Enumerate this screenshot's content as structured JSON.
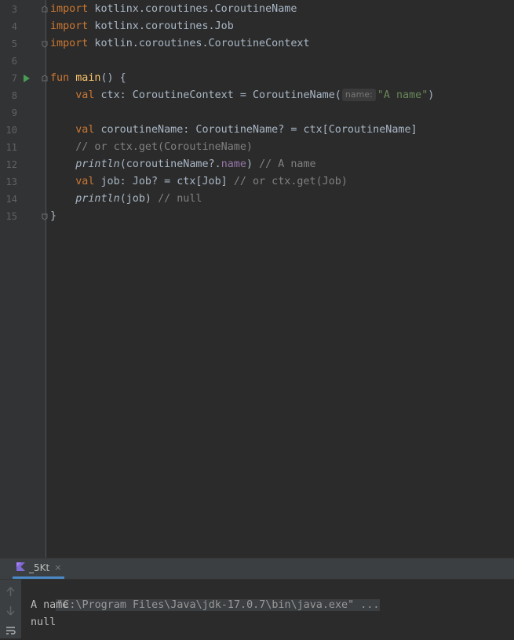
{
  "editor": {
    "lines": [
      {
        "num": "3",
        "segs": [
          {
            "t": "import",
            "c": "kw"
          },
          {
            "t": " kotlinx.coroutines.CoroutineName",
            "c": ""
          }
        ]
      },
      {
        "num": "4",
        "segs": [
          {
            "t": "import",
            "c": "kw"
          },
          {
            "t": " kotlinx.coroutines.Job",
            "c": ""
          }
        ]
      },
      {
        "num": "5",
        "segs": [
          {
            "t": "import",
            "c": "kw"
          },
          {
            "t": " kotlin.coroutines.CoroutineContext",
            "c": ""
          }
        ]
      },
      {
        "num": "6",
        "segs": []
      },
      {
        "num": "7",
        "segs": [
          {
            "t": "fun",
            "c": "kw"
          },
          {
            "t": " ",
            "c": ""
          },
          {
            "t": "main",
            "c": "fn"
          },
          {
            "t": "() {",
            "c": ""
          }
        ]
      },
      {
        "num": "8",
        "segs": [
          {
            "t": "    ",
            "c": ""
          },
          {
            "t": "val",
            "c": "kw"
          },
          {
            "t": " ctx: CoroutineContext = CoroutineName(",
            "c": ""
          },
          {
            "t": "name:",
            "c": "hint"
          },
          {
            "t": "\"A name\"",
            "c": "str"
          },
          {
            "t": ")",
            "c": ""
          }
        ]
      },
      {
        "num": "9",
        "segs": []
      },
      {
        "num": "10",
        "segs": [
          {
            "t": "    ",
            "c": ""
          },
          {
            "t": "val",
            "c": "kw"
          },
          {
            "t": " coroutineName: CoroutineName? = ctx[CoroutineName]",
            "c": ""
          }
        ]
      },
      {
        "num": "11",
        "segs": [
          {
            "t": "    ",
            "c": ""
          },
          {
            "t": "// or ctx.get(CoroutineName)",
            "c": "cm"
          }
        ]
      },
      {
        "num": "12",
        "segs": [
          {
            "t": "    ",
            "c": ""
          },
          {
            "t": "println",
            "c": "it"
          },
          {
            "t": "(coroutineName?.",
            "c": ""
          },
          {
            "t": "name",
            "c": "prop"
          },
          {
            "t": ") ",
            "c": ""
          },
          {
            "t": "// A name",
            "c": "cm"
          }
        ]
      },
      {
        "num": "13",
        "segs": [
          {
            "t": "    ",
            "c": ""
          },
          {
            "t": "val",
            "c": "kw"
          },
          {
            "t": " job: Job? = ctx[Job] ",
            "c": ""
          },
          {
            "t": "// or ctx.get(Job)",
            "c": "cm"
          }
        ]
      },
      {
        "num": "14",
        "segs": [
          {
            "t": "    ",
            "c": ""
          },
          {
            "t": "println",
            "c": "it"
          },
          {
            "t": "(job) ",
            "c": ""
          },
          {
            "t": "// null",
            "c": "cm"
          }
        ]
      },
      {
        "num": "15",
        "segs": [
          {
            "t": "}",
            "c": ""
          }
        ]
      }
    ],
    "run_gutter_line": "7",
    "fold_lines": [
      "3",
      "5",
      "7",
      "15"
    ]
  },
  "run_panel": {
    "tab_label": "_5Kt",
    "tab_close": "×",
    "icons": [
      "up-arrow-icon",
      "down-arrow-icon",
      "soft-wrap-icon"
    ],
    "output": [
      "\"C:\\Program Files\\Java\\jdk-17.0.7\\bin\\java.exe\" ...",
      "A name",
      "null"
    ]
  },
  "colors": {
    "keyword": "#cc7832",
    "function": "#ffc66d",
    "string": "#6a8759",
    "comment": "#808080",
    "property": "#9876aa",
    "text": "#a9b7c6",
    "run_icon": "#499c54",
    "tab_underline": "#4a88c7"
  }
}
